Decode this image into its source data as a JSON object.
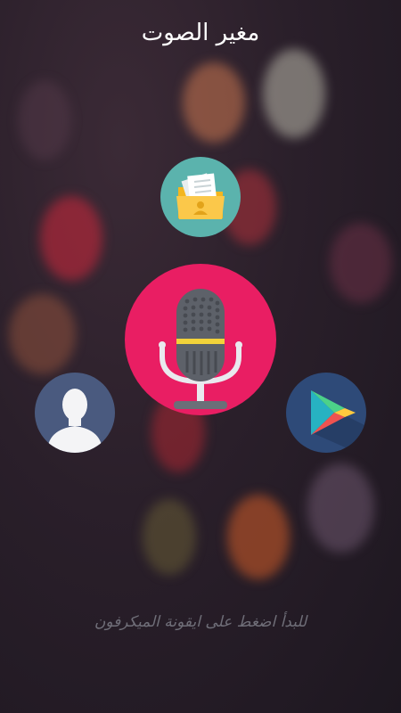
{
  "header": {
    "title": "مغير الصوت"
  },
  "actions": {
    "files_icon": "folder-files-icon",
    "mic_icon": "microphone-icon",
    "profile_icon": "user-profile-icon",
    "store_icon": "play-store-icon"
  },
  "footer": {
    "hint": "للبدأ اضغط على ايقونة الميكرفون"
  },
  "colors": {
    "mic_circle": "#e91e63",
    "files_circle": "#5bb3ad",
    "profile_circle": "#4a5a7f",
    "store_circle": "#2e4a78"
  }
}
